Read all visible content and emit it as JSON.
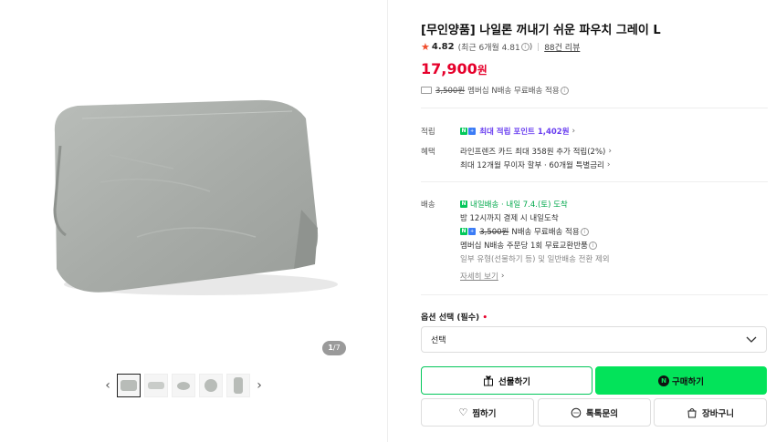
{
  "gallery": {
    "counter_current": "1",
    "counter_total": "/7",
    "prev_icon": "chevron-left-icon",
    "next_icon": "chevron-right-icon",
    "thumb_count": 5
  },
  "product": {
    "title": "[무인양품] 나일론 꺼내기 쉬운 파우치 그레이 L",
    "rating": "4.82",
    "rating_recent": "(최근 6개월 4.81",
    "rating_recent_close": ")",
    "review_link": "88건 리뷰",
    "price": "17,900",
    "price_unit": "원",
    "shipping_strike": "3,500원",
    "shipping_text": "멤버십 N배송 무료배송 적용"
  },
  "details": {
    "points_label": "적립",
    "points_text": "최대 적립 포인트 1,402원",
    "benefit_label": "혜택",
    "benefit_line1": "라인프렌즈 카드 최대 358원 추가 적립(2%)",
    "benefit_line2": "최대 12개월 무이자 할부 · 60개월 특별금리",
    "delivery_label": "배송",
    "delivery_badge": "내일배송",
    "delivery_arrival": "· 내일 7.4.(토) 도착",
    "delivery_line2": "밤 12시까지 결제 시 내일도착",
    "delivery_strike": "3,500원",
    "delivery_line3": "N배송 무료배송 적용",
    "delivery_line4": "멤버십 N배송 주문당 1회 무료교환반품",
    "delivery_line5": "일부 유형(선물하기 등) 및 일반배송 전환 제외",
    "more_link": "자세히 보기"
  },
  "option": {
    "label": "옵션 선택 (필수)",
    "required_mark": "•",
    "select_value": "선택"
  },
  "buttons": {
    "gift": "선물하기",
    "buy": "구매하기",
    "wish": "찜하기",
    "talk": "톡톡문의",
    "cart": "장바구니"
  },
  "colors": {
    "price_red": "#e6002b",
    "naver_green": "#03e35a",
    "points_purple": "#6a3ff0"
  }
}
